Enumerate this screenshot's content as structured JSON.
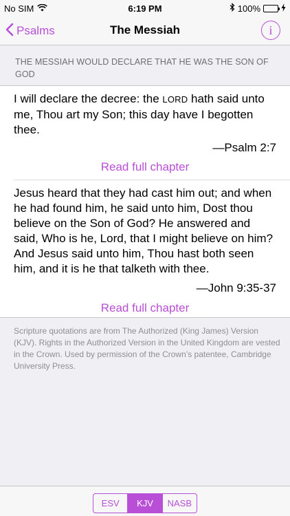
{
  "status": {
    "carrier": "No SIM",
    "time": "6:19 PM",
    "battery": "100%"
  },
  "nav": {
    "back_label": "Psalms",
    "title": "The Messiah",
    "info_label": "i"
  },
  "section": {
    "header": "THE MESSIAH WOULD DECLARE THAT HE WAS THE SON OF GOD"
  },
  "verses": [
    {
      "text_before": "I will declare the decree: the ",
      "lord": "Lord",
      "text_after": " hath said unto me, Thou art my Son; this day have I begotten thee.",
      "reference": "—Psalm 2:7",
      "link": "Read full chapter"
    },
    {
      "text": "Jesus heard that they had cast him out; and when he had found him, he said unto him, Dost thou believe on the Son of God? He answered and said, Who is he, Lord, that I might believe on him? And Jesus said unto him, Thou hast both seen him, and it is he that talketh with thee.",
      "reference": "—John 9:35-37",
      "link": "Read full chapter"
    }
  ],
  "footer": {
    "note": "Scripture quotations are from The Authorized (King James) Version (KJV). Rights in the Authorized Version in the United Kingdom are vested in the Crown. Used by permission of the Crown’s patentee, Cambridge University Press."
  },
  "translations": [
    {
      "label": "ESV"
    },
    {
      "label": "KJV"
    },
    {
      "label": "NASB"
    }
  ],
  "selected_translation": "KJV",
  "colors": {
    "accent": "#b84fd6",
    "background": "#efeff4"
  },
  "icons": {
    "wifi": "wifi-icon",
    "bluetooth": "bluetooth-icon",
    "battery": "battery-icon",
    "charging": "bolt-icon",
    "back": "chevron-left-icon",
    "info": "info-icon"
  }
}
